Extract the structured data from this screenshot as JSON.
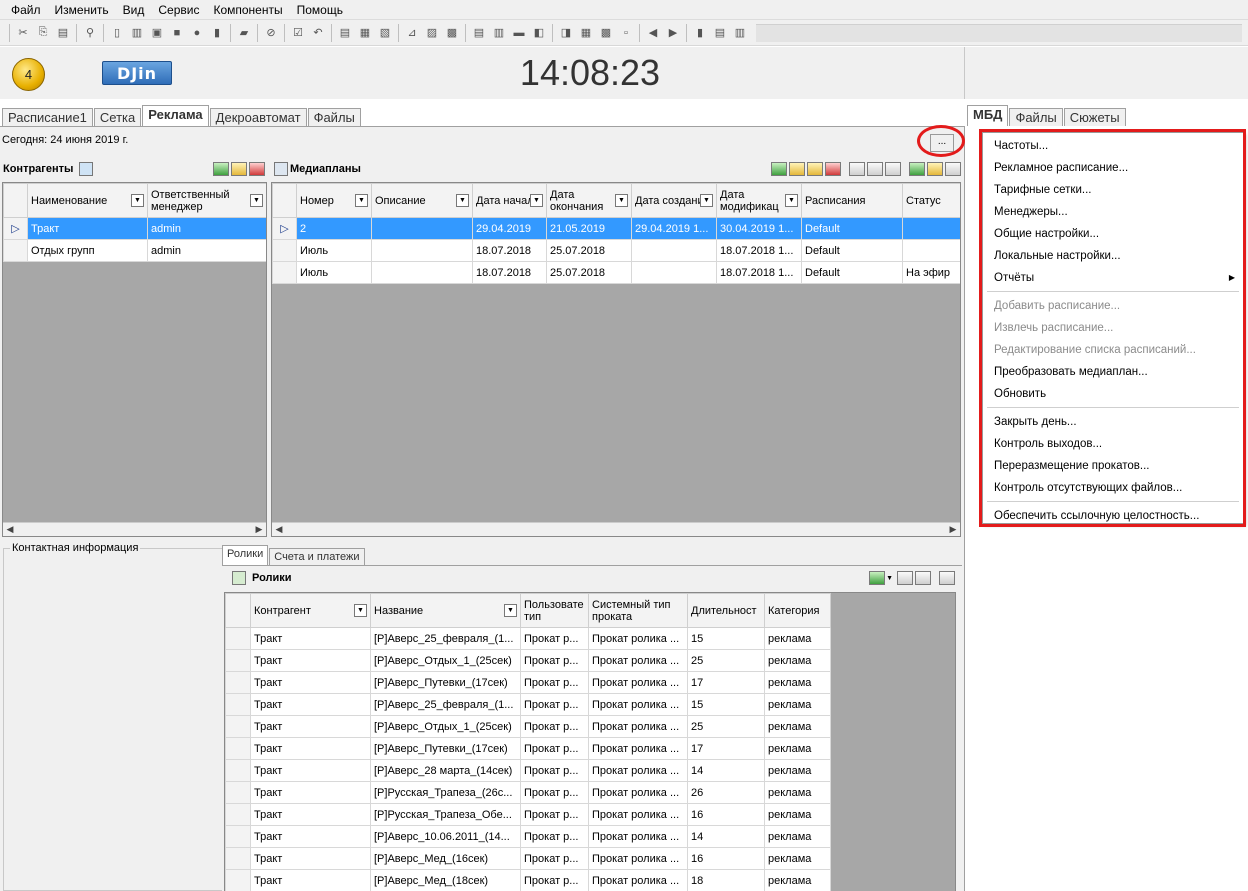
{
  "menu": [
    "Файл",
    "Изменить",
    "Вид",
    "Сервис",
    "Компоненты",
    "Помощь"
  ],
  "header": {
    "badge": "4",
    "logo": "DJin",
    "clock": "14:08:23"
  },
  "main_tabs": [
    "Расписание1",
    "Сетка",
    "Реклама",
    "Декроавтомат",
    "Файлы"
  ],
  "main_active": "Реклама",
  "right_tabs": [
    "МБД",
    "Файлы",
    "Сюжеты"
  ],
  "today": "Сегодня: 24 июня 2019 г.",
  "dots_button": "...",
  "contractors": {
    "title": "Контрагенты",
    "columns": [
      "Наименование",
      "Ответственный менеджер"
    ],
    "rows": [
      [
        "Тракт",
        "admin"
      ],
      [
        "Отдых групп",
        "admin"
      ]
    ]
  },
  "mediaplans": {
    "title": "Медиапланы",
    "columns": [
      "Номер",
      "Описание",
      "Дата начала",
      "Дата окончания",
      "Дата создания",
      "Дата модификац",
      "Расписания",
      "Статус"
    ],
    "rows": [
      [
        "2",
        "",
        "29.04.2019",
        "21.05.2019",
        "29.04.2019 1...",
        "30.04.2019 1...",
        "Default",
        ""
      ],
      [
        "Июль",
        "",
        "18.07.2018",
        "25.07.2018",
        "",
        "18.07.2018 1...",
        "Default",
        ""
      ],
      [
        "Июль",
        "",
        "18.07.2018",
        "25.07.2018",
        "",
        "18.07.2018 1...",
        "Default",
        "На эфир"
      ]
    ]
  },
  "contact_info": "Контактная информация",
  "sub_tabs": [
    "Ролики",
    "Счета и платежи"
  ],
  "clips": {
    "title": "Ролики",
    "columns": [
      "Контрагент",
      "Название",
      "Пользовате тип",
      "Системный тип проката",
      "Длительност",
      "Категория"
    ],
    "rows": [
      [
        "Тракт",
        "[Р]Аверс_25_февраля_(1...",
        "Прокат р...",
        "Прокат ролика ...",
        "15",
        "реклама"
      ],
      [
        "Тракт",
        "[Р]Аверс_Отдых_1_(25сек)",
        "Прокат р...",
        "Прокат ролика ...",
        "25",
        "реклама"
      ],
      [
        "Тракт",
        "[Р]Аверс_Путевки_(17сек)",
        "Прокат р...",
        "Прокат ролика ...",
        "17",
        "реклама"
      ],
      [
        "Тракт",
        "[Р]Аверс_25_февраля_(1...",
        "Прокат р...",
        "Прокат ролика ...",
        "15",
        "реклама"
      ],
      [
        "Тракт",
        "[Р]Аверс_Отдых_1_(25сек)",
        "Прокат р...",
        "Прокат ролика ...",
        "25",
        "реклама"
      ],
      [
        "Тракт",
        "[Р]Аверс_Путевки_(17сек)",
        "Прокат р...",
        "Прокат ролика ...",
        "17",
        "реклама"
      ],
      [
        "Тракт",
        "[Р]Аверс_28 марта_(14сек)",
        "Прокат р...",
        "Прокат ролика ...",
        "14",
        "реклама"
      ],
      [
        "Тракт",
        "[Р]Русская_Трапеза_(26с...",
        "Прокат р...",
        "Прокат ролика ...",
        "26",
        "реклама"
      ],
      [
        "Тракт",
        "[Р]Русская_Трапеза_Обе...",
        "Прокат р...",
        "Прокат ролика ...",
        "16",
        "реклама"
      ],
      [
        "Тракт",
        "[Р]Аверс_10.06.2011_(14...",
        "Прокат р...",
        "Прокат ролика ...",
        "14",
        "реклама"
      ],
      [
        "Тракт",
        "[Р]Аверс_Мед_(16сек)",
        "Прокат р...",
        "Прокат ролика ...",
        "16",
        "реклама"
      ],
      [
        "Тракт",
        "[Р]Аверс_Мед_(18сек)",
        "Прокат р...",
        "Прокат ролика ...",
        "18",
        "реклама"
      ]
    ]
  },
  "context_menu": {
    "groups": [
      [
        {
          "label": "Частоты...",
          "enabled": true
        },
        {
          "label": "Рекламное расписание...",
          "enabled": true
        },
        {
          "label": "Тарифные сетки...",
          "enabled": true
        },
        {
          "label": "Менеджеры...",
          "enabled": true
        },
        {
          "label": "Общие настройки...",
          "enabled": true
        },
        {
          "label": "Локальные настройки...",
          "enabled": true
        },
        {
          "label": "Отчёты",
          "enabled": true,
          "submenu": true
        }
      ],
      [
        {
          "label": "Добавить расписание...",
          "enabled": false
        },
        {
          "label": "Извлечь расписание...",
          "enabled": false
        },
        {
          "label": "Редактирование списка расписаний...",
          "enabled": false
        },
        {
          "label": "Преобразовать медиаплан...",
          "enabled": true
        },
        {
          "label": "Обновить",
          "enabled": true
        }
      ],
      [
        {
          "label": "Закрыть день...",
          "enabled": true
        },
        {
          "label": "Контроль выходов...",
          "enabled": true
        },
        {
          "label": "Переразмещение прокатов...",
          "enabled": true
        },
        {
          "label": "Контроль отсутствующих файлов...",
          "enabled": true
        }
      ],
      [
        {
          "label": "Обеспечить ссылочную целостность...",
          "enabled": true
        }
      ]
    ]
  },
  "colors": {
    "selection": "#3399ff",
    "highlight": "#e31b1b"
  }
}
